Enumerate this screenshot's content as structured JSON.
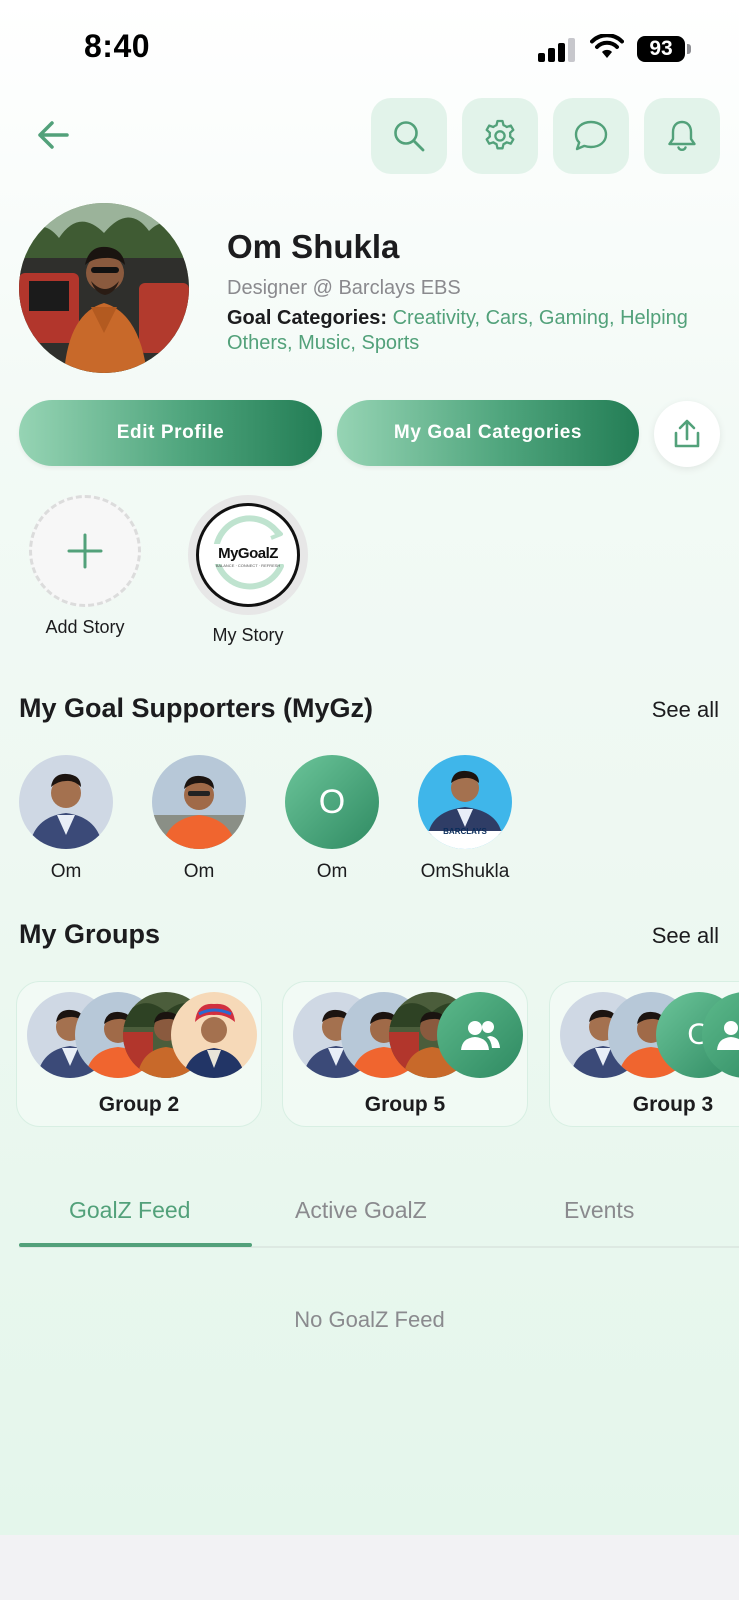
{
  "status_bar": {
    "time": "8:40",
    "battery": "93"
  },
  "nav": {
    "back_icon": "arrow-left-icon",
    "actions": [
      {
        "name": "search-button",
        "icon": "search-icon"
      },
      {
        "name": "settings-button",
        "icon": "gear-icon"
      },
      {
        "name": "chat-button",
        "icon": "chat-bubble-icon"
      },
      {
        "name": "notifications-button",
        "icon": "bell-icon"
      }
    ]
  },
  "profile": {
    "name": "Om Shukla",
    "role": "Designer  @ Barclays EBS",
    "goals_label": "Goal Categories:",
    "goals_value": "Creativity, Cars, Gaming, Helping Others, Music, Sports"
  },
  "actions": {
    "edit_profile": "Edit Profile",
    "my_goal_categories": "My Goal Categories",
    "share_icon": "share-icon"
  },
  "stories": {
    "add_label": "Add Story",
    "mine_label": "My Story",
    "logo_text": "MyGoalZ",
    "logo_tagline": "BALANCE · CONNECT · REFRESH"
  },
  "supporters": {
    "title": "My Goal Supporters (MyGz)",
    "see_all": "See all",
    "items": [
      {
        "name": "Om",
        "initial": ""
      },
      {
        "name": "Om",
        "initial": ""
      },
      {
        "name": "Om",
        "initial": "O"
      },
      {
        "name": "OmShukla",
        "initial": "",
        "badge": "BARCLAYS"
      }
    ]
  },
  "groups": {
    "title": "My Groups",
    "see_all": "See all",
    "items": [
      {
        "name": "Group 2"
      },
      {
        "name": "Group 5"
      },
      {
        "name": "Group 3",
        "initial": "O"
      }
    ]
  },
  "tabs": {
    "items": [
      "GoalZ Feed",
      "Active GoalZ",
      "Events"
    ],
    "active": "GoalZ Feed"
  },
  "feed": {
    "empty_message": "No GoalZ Feed"
  },
  "colors": {
    "accent": "#52a17a",
    "accent_dark": "#237d55",
    "accent_light": "#96d4b4"
  }
}
